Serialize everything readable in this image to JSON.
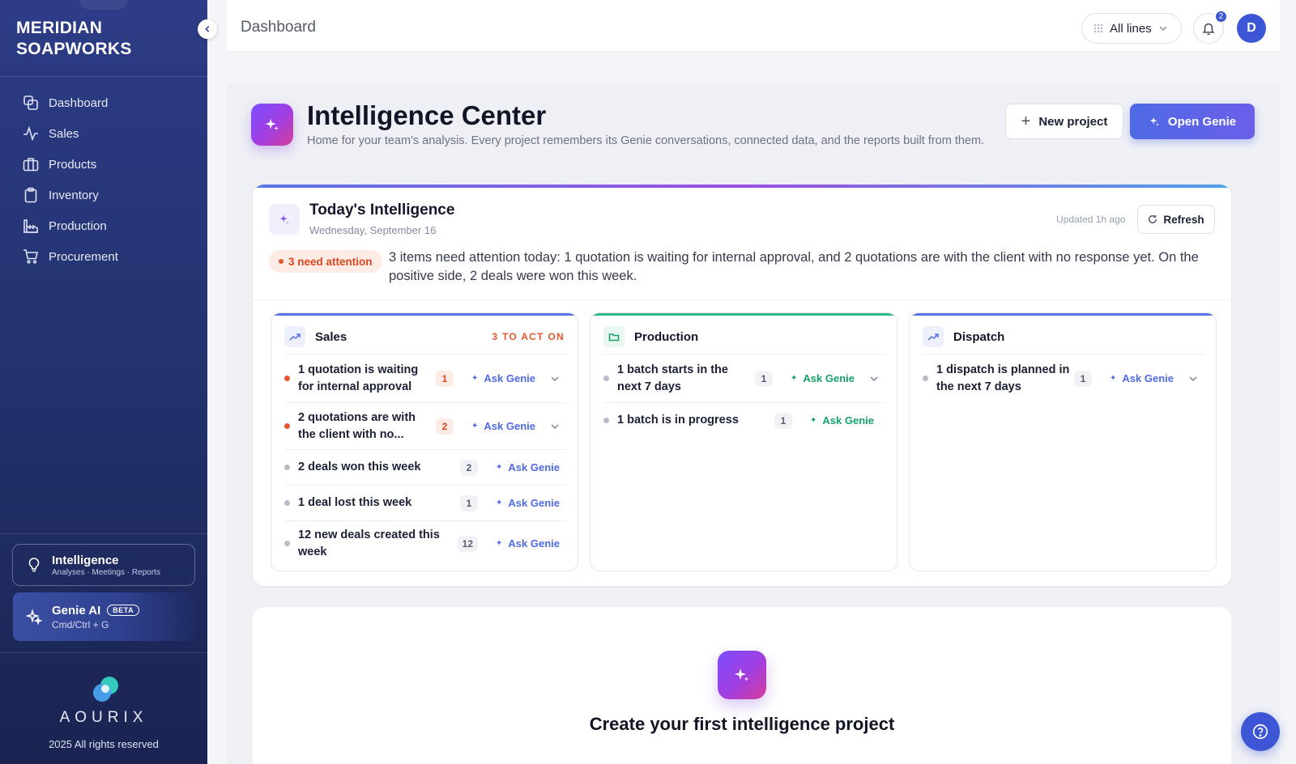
{
  "sidebar": {
    "brand_line1": "MERIDIAN",
    "brand_line2": "SOAPWORKS",
    "items": [
      {
        "label": "Dashboard",
        "icon": "dashboard-icon"
      },
      {
        "label": "Sales",
        "icon": "activity-icon"
      },
      {
        "label": "Products",
        "icon": "briefcase-icon"
      },
      {
        "label": "Inventory",
        "icon": "clipboard-icon"
      },
      {
        "label": "Production",
        "icon": "factory-icon"
      },
      {
        "label": "Procurement",
        "icon": "cart-icon"
      }
    ],
    "intelligence": {
      "title": "Intelligence",
      "subtitle": "Analyses · Meetings · Reports"
    },
    "genie": {
      "title": "Genie AI",
      "badge": "BETA",
      "shortcut": "Cmd/Ctrl + G"
    },
    "footer_logo": "AOURIX",
    "footer_rights": "2025 All rights reserved"
  },
  "topbar": {
    "title": "Dashboard",
    "lines_select": "All lines",
    "notifications_count": "2",
    "avatar_initial": "D"
  },
  "hero": {
    "title": "Intelligence Center",
    "subtitle": "Home for your team's analysis. Every project remembers its Genie conversations, connected data, and the reports built from them.",
    "new_project_label": "New project",
    "open_genie_label": "Open Genie"
  },
  "today": {
    "title": "Today's Intelligence",
    "date": "Wednesday, September 16",
    "updated": "Updated 1h ago",
    "refresh_label": "Refresh",
    "attention_pill": "3 need attention",
    "summary": "3 items need attention today: 1 quotation is waiting for internal approval, and 2 quotations are with the client with no response yet. On the positive side, 2 deals were won this week.",
    "ask_label": "Ask Genie",
    "panels": [
      {
        "title": "Sales",
        "tag": "3 TO ACT ON",
        "rows": [
          {
            "text": "1 quotation is waiting for internal approval",
            "count": "1",
            "hot": true,
            "expand": true
          },
          {
            "text": "2 quotations are with the client with no...",
            "count": "2",
            "hot": true,
            "expand": true
          },
          {
            "text": "2 deals won this week",
            "count": "2",
            "hot": false,
            "expand": false
          },
          {
            "text": "1 deal lost this week",
            "count": "1",
            "hot": false,
            "expand": false
          },
          {
            "text": "12 new deals created this week",
            "count": "12",
            "hot": false,
            "expand": false
          }
        ]
      },
      {
        "title": "Production",
        "tag": "",
        "rows": [
          {
            "text": "1 batch starts in the next 7 days",
            "count": "1",
            "hot": false,
            "expand": true
          },
          {
            "text": "1 batch is in progress",
            "count": "1",
            "hot": false,
            "expand": false
          }
        ]
      },
      {
        "title": "Dispatch",
        "tag": "",
        "rows": [
          {
            "text": "1 dispatch is planned in the next 7 days",
            "count": "1",
            "hot": false,
            "expand": true
          }
        ]
      }
    ]
  },
  "create": {
    "title": "Create your first intelligence project"
  },
  "colors": {
    "accent": "#3d56d6",
    "sales": "#4f6ae6",
    "production": "#16a36b",
    "dispatch": "#4f6ae6",
    "attention": "#e4572e"
  }
}
